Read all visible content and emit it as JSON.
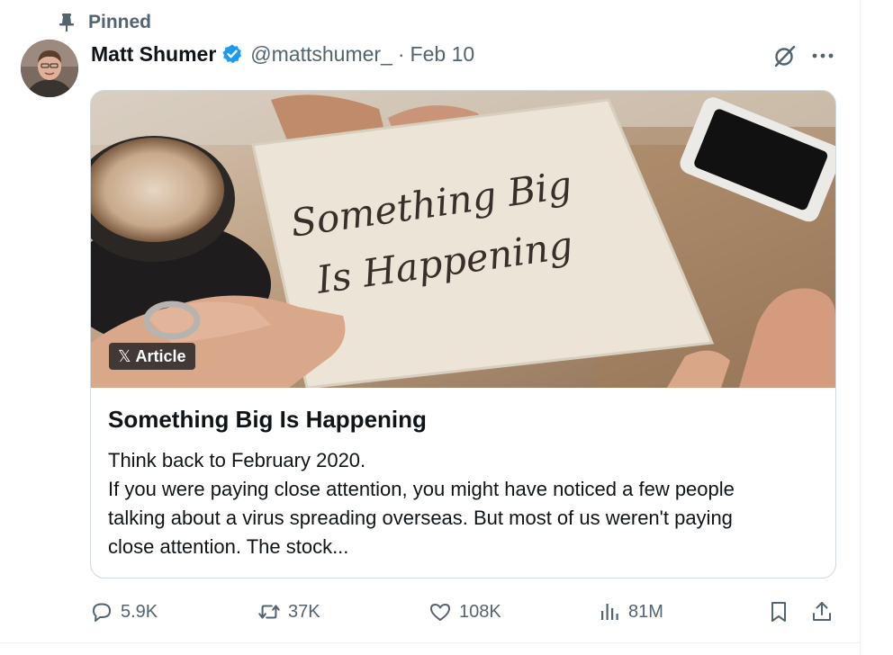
{
  "pinned": {
    "label": "Pinned"
  },
  "author": {
    "name": "Matt Shumer",
    "handle": "@mattshumer_",
    "separator": "·",
    "date": "Feb 10"
  },
  "article": {
    "badge_label": "Article",
    "image_text": [
      "Something Big",
      "Is Happening"
    ],
    "title": "Something Big Is Happening",
    "excerpt_lines": [
      "Think back to February 2020.",
      "If you were paying close attention, you might have noticed a few people",
      "talking about a virus spreading overseas. But most of us weren't paying",
      "close attention. The stock..."
    ]
  },
  "actions": {
    "replies": "5.9K",
    "reposts": "37K",
    "likes": "108K",
    "views": "81M"
  },
  "icons": {
    "pin": "pin-icon",
    "verified": "verified-badge-icon",
    "grok": "grok-icon",
    "more": "more-icon",
    "reply": "reply-icon",
    "repost": "repost-icon",
    "like": "heart-icon",
    "views": "views-chart-icon",
    "bookmark": "bookmark-icon",
    "share": "share-icon",
    "x_logo": "x-logo-icon"
  },
  "colors": {
    "text": "#0f1419",
    "secondary": "#536471",
    "verified": "#1d9bf0",
    "border": "#cfd9de"
  }
}
